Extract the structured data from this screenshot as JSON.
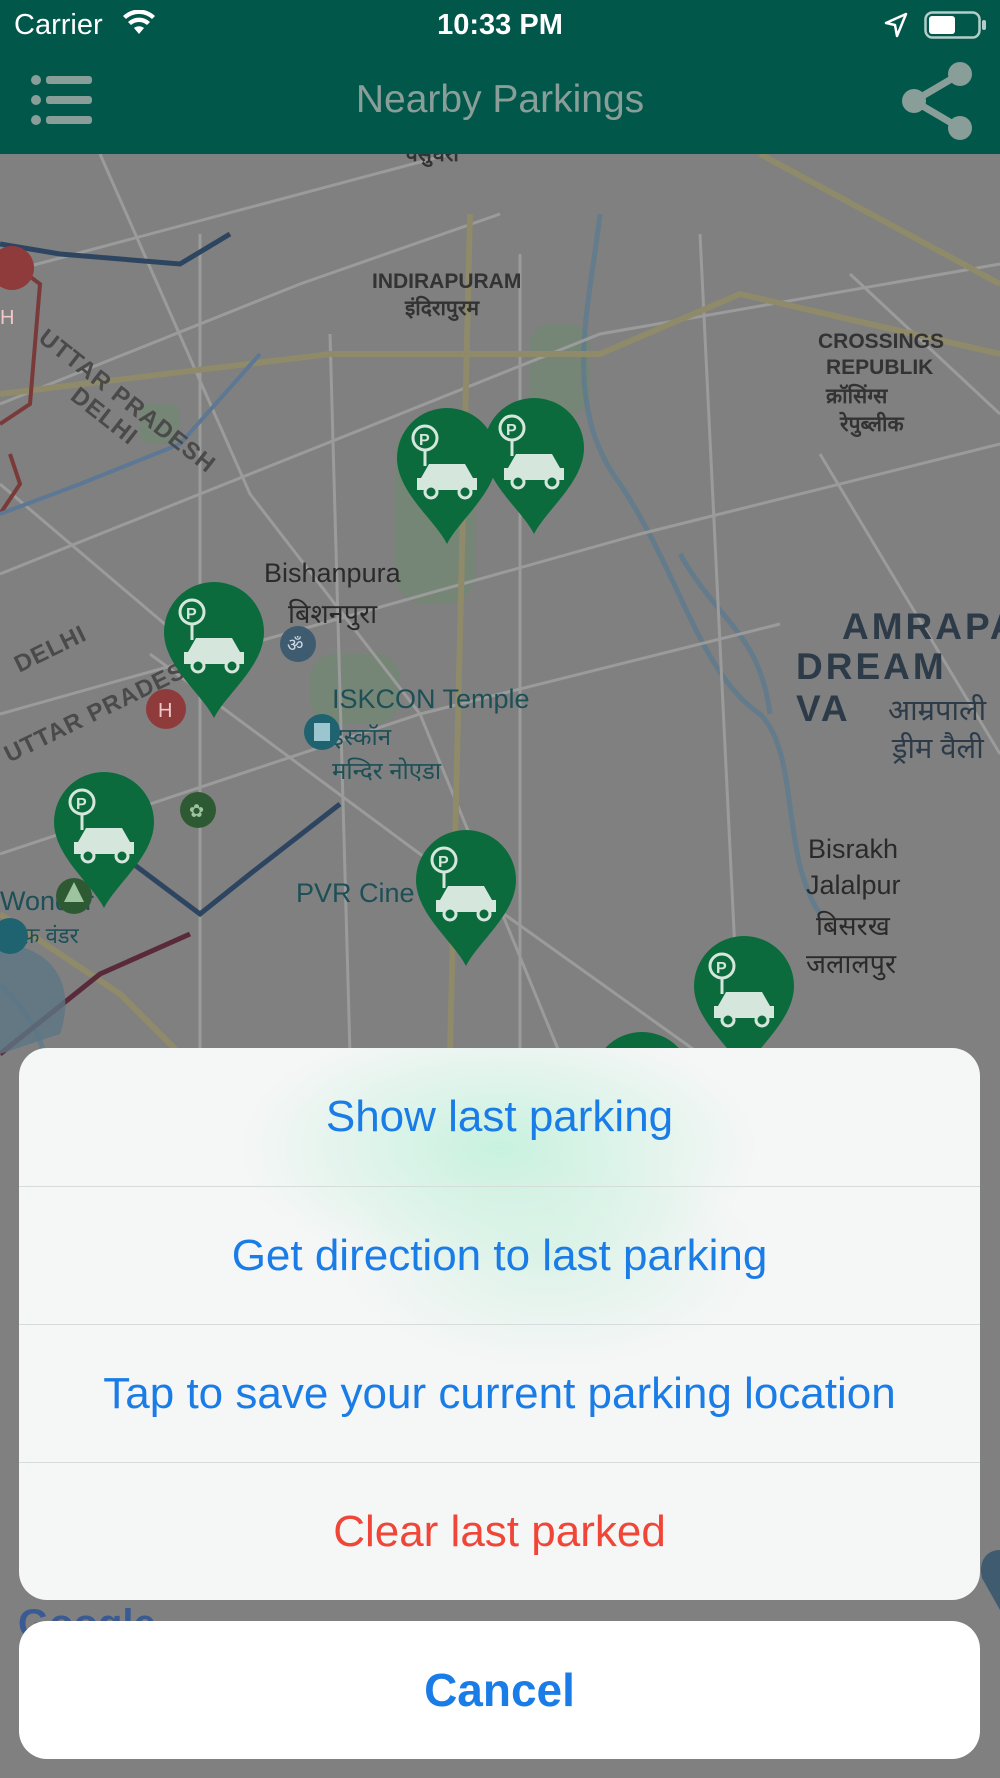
{
  "status_bar": {
    "carrier": "Carrier",
    "time": "10:33 PM"
  },
  "navbar": {
    "title": "Nearby Parkings",
    "menu_icon": "hamburger-menu-icon",
    "share_icon": "share-icon",
    "background": "#00574a"
  },
  "map": {
    "labels": {
      "vasundhara": "वसुंधरा",
      "indirapuram_en": "INDIRAPURAM",
      "indirapuram_hi": "इंदिरापुरम",
      "crossings_1": "CROSSINGS",
      "crossings_2": "REPUBLIK",
      "crossings_hi_1": "क्रॉसिंग्स",
      "crossings_hi_2": "रेपुब्लीक",
      "uttar_pradesh_1": "UTTAR PRADESH",
      "delhi_1": "DELHI",
      "bishanpura_en": "Bishanpura",
      "bishanpura_hi": "बिशनपुरा",
      "amrapali_1": "AMRAPA",
      "amrapali_2": "DREAM VA",
      "amrapali_hi_1": "आम्रपाली",
      "amrapali_hi_2": "ड्रीम वैली",
      "delhi_2": "DELHI",
      "uttar_pradesh_2": "UTTAR PRADESH",
      "iskcon_en": "ISKCON Temple",
      "iskcon_hi_1": "इस्कॉन",
      "iskcon_hi_2": "मन्दिर नोएडा",
      "bisrakh_1": "Bisrakh",
      "bisrakh_2": "Jalalpur",
      "bisrakh_hi_1": "बिसरख",
      "bisrakh_hi_2": "जलालपुर",
      "wonder_en": "Wonder",
      "wonder_hi": "ऑफ़ वंडर",
      "pvr": "PVR Cine",
      "google": "Google"
    },
    "pin_color": "#0b6b3c",
    "pin_icon": "parking-car-pin-icon"
  },
  "action_sheet": {
    "items": [
      {
        "label": "Show last parking"
      },
      {
        "label": "Get direction to last parking"
      },
      {
        "label": "Tap to save your current parking location"
      },
      {
        "label": "Clear last parked"
      }
    ],
    "cancel_label": "Cancel",
    "accent_color": "#1a7ce6",
    "destructive_color": "#f04638"
  }
}
